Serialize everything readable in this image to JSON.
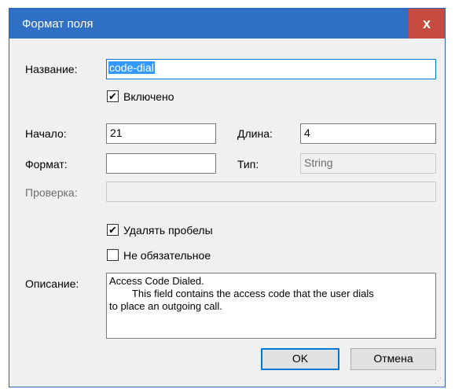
{
  "window": {
    "title": "Формат поля",
    "close_label": "x"
  },
  "fields": {
    "name_label": "Название:",
    "name_value": "code-dial",
    "enabled_label": "Включено",
    "enabled_checked": true,
    "start_label": "Начало:",
    "start_value": "21",
    "length_label": "Длина:",
    "length_value": "4",
    "format_label": "Формат:",
    "format_value": "",
    "type_label": "Тип:",
    "type_value": "String",
    "check_label": "Проверка:",
    "check_value": "",
    "trim_label": "Удалять пробелы",
    "trim_checked": true,
    "optional_label": "Не обязательное",
    "optional_checked": false,
    "description_label": "Описание:",
    "description_value": "Access Code Dialed.\n        This field contains the access code that the user dials\nto place an outgoing call."
  },
  "buttons": {
    "ok": "OK",
    "cancel": "Отмена"
  },
  "icons": {
    "close": "close-icon",
    "checkmark": "checkmark-icon",
    "grip": "resize-grip-icon"
  }
}
